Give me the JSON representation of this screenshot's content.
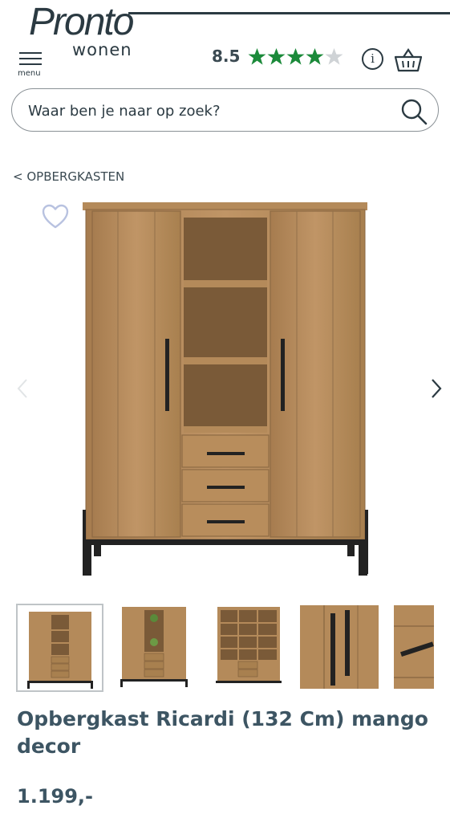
{
  "header": {
    "logo_main": "Pronto",
    "logo_sub": "wonen",
    "menu_label": "menu",
    "rating_score": "8.5",
    "rating_stars": 4,
    "rating_max": 5,
    "info_glyph": "i",
    "star_color": "#1b8a3a"
  },
  "search": {
    "placeholder": "Waar ben je naar op zoek?"
  },
  "breadcrumb": {
    "label": "< OPBERGKASTEN"
  },
  "gallery": {
    "thumbnail_count": 5,
    "active_index": 0
  },
  "product": {
    "title": "Opbergkast Ricardi (132 Cm) mango decor",
    "price": "1.199,-"
  },
  "colors": {
    "text": "#3d5563",
    "wood": "#b48a5a",
    "metal": "#222222"
  }
}
